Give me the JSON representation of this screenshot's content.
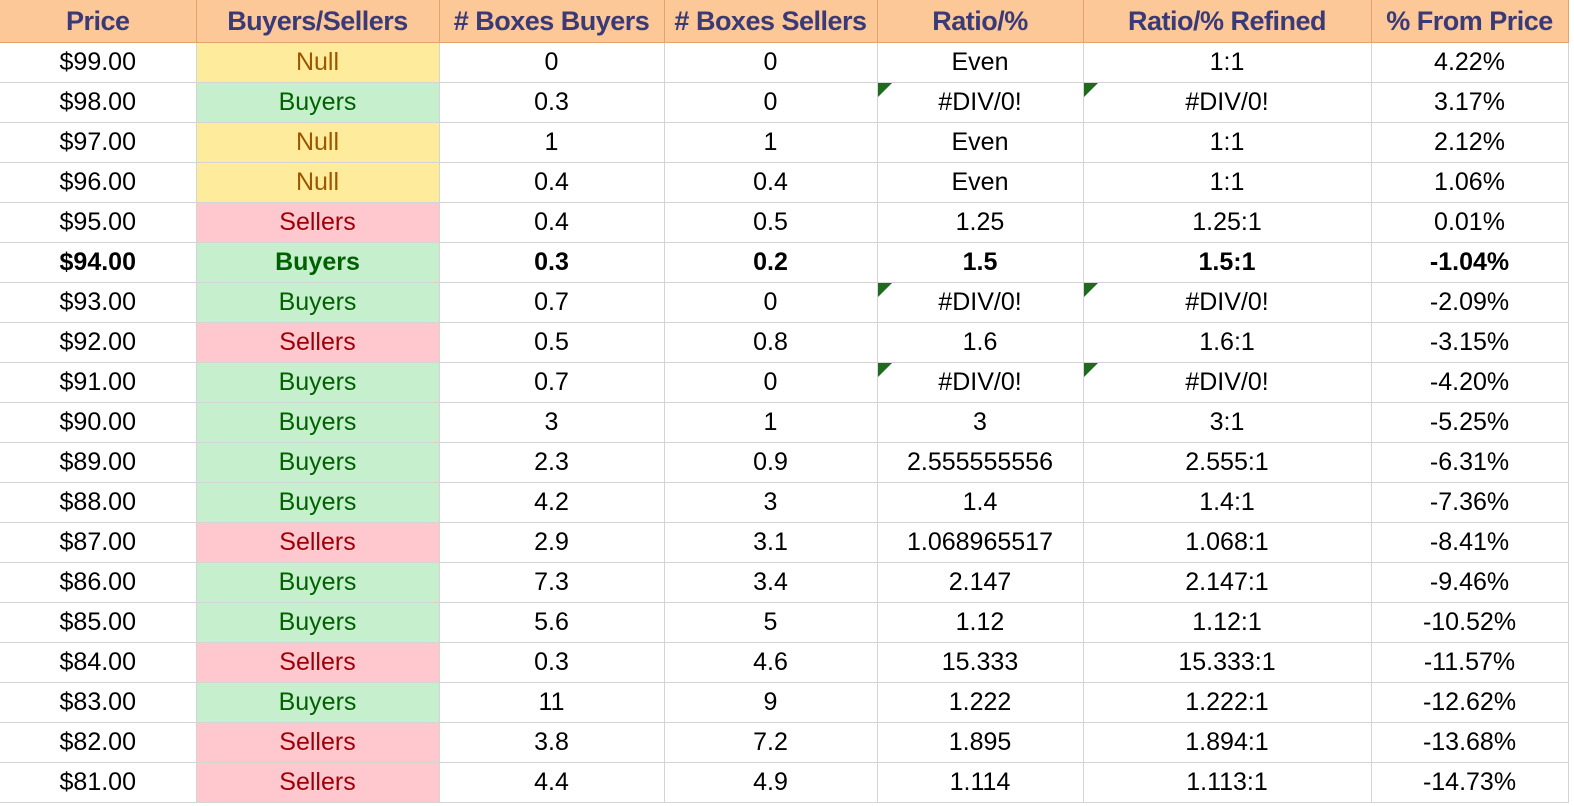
{
  "columns": [
    "Price",
    "Buyers/Sellers",
    "# Boxes Buyers",
    "# Boxes Sellers",
    "Ratio/%",
    "Ratio/% Refined",
    "% From Price"
  ],
  "rows": [
    {
      "price": "$99.00",
      "side": "Null",
      "side_type": "null",
      "buyers": "0",
      "sellers": "0",
      "ratio": "Even",
      "refined": "1:1",
      "from_price": "4.22%",
      "error_flag": false,
      "bold": false
    },
    {
      "price": "$98.00",
      "side": "Buyers",
      "side_type": "buyers",
      "buyers": "0.3",
      "sellers": "0",
      "ratio": "#DIV/0!",
      "refined": "#DIV/0!",
      "from_price": "3.17%",
      "error_flag": true,
      "bold": false
    },
    {
      "price": "$97.00",
      "side": "Null",
      "side_type": "null",
      "buyers": "1",
      "sellers": "1",
      "ratio": "Even",
      "refined": "1:1",
      "from_price": "2.12%",
      "error_flag": false,
      "bold": false
    },
    {
      "price": "$96.00",
      "side": "Null",
      "side_type": "null",
      "buyers": "0.4",
      "sellers": "0.4",
      "ratio": "Even",
      "refined": "1:1",
      "from_price": "1.06%",
      "error_flag": false,
      "bold": false
    },
    {
      "price": "$95.00",
      "side": "Sellers",
      "side_type": "sellers",
      "buyers": "0.4",
      "sellers": "0.5",
      "ratio": "1.25",
      "refined": "1.25:1",
      "from_price": "0.01%",
      "error_flag": false,
      "bold": false
    },
    {
      "price": "$94.00",
      "side": "Buyers",
      "side_type": "buyers",
      "buyers": "0.3",
      "sellers": "0.2",
      "ratio": "1.5",
      "refined": "1.5:1",
      "from_price": "-1.04%",
      "error_flag": false,
      "bold": true
    },
    {
      "price": "$93.00",
      "side": "Buyers",
      "side_type": "buyers",
      "buyers": "0.7",
      "sellers": "0",
      "ratio": "#DIV/0!",
      "refined": "#DIV/0!",
      "from_price": "-2.09%",
      "error_flag": true,
      "bold": false
    },
    {
      "price": "$92.00",
      "side": "Sellers",
      "side_type": "sellers",
      "buyers": "0.5",
      "sellers": "0.8",
      "ratio": "1.6",
      "refined": "1.6:1",
      "from_price": "-3.15%",
      "error_flag": false,
      "bold": false
    },
    {
      "price": "$91.00",
      "side": "Buyers",
      "side_type": "buyers",
      "buyers": "0.7",
      "sellers": "0",
      "ratio": "#DIV/0!",
      "refined": "#DIV/0!",
      "from_price": "-4.20%",
      "error_flag": true,
      "bold": false
    },
    {
      "price": "$90.00",
      "side": "Buyers",
      "side_type": "buyers",
      "buyers": "3",
      "sellers": "1",
      "ratio": "3",
      "refined": "3:1",
      "from_price": "-5.25%",
      "error_flag": false,
      "bold": false
    },
    {
      "price": "$89.00",
      "side": "Buyers",
      "side_type": "buyers",
      "buyers": "2.3",
      "sellers": "0.9",
      "ratio": "2.555555556",
      "refined": "2.555:1",
      "from_price": "-6.31%",
      "error_flag": false,
      "bold": false
    },
    {
      "price": "$88.00",
      "side": "Buyers",
      "side_type": "buyers",
      "buyers": "4.2",
      "sellers": "3",
      "ratio": "1.4",
      "refined": "1.4:1",
      "from_price": "-7.36%",
      "error_flag": false,
      "bold": false
    },
    {
      "price": "$87.00",
      "side": "Sellers",
      "side_type": "sellers",
      "buyers": "2.9",
      "sellers": "3.1",
      "ratio": "1.068965517",
      "refined": "1.068:1",
      "from_price": "-8.41%",
      "error_flag": false,
      "bold": false
    },
    {
      "price": "$86.00",
      "side": "Buyers",
      "side_type": "buyers",
      "buyers": "7.3",
      "sellers": "3.4",
      "ratio": "2.147",
      "refined": "2.147:1",
      "from_price": "-9.46%",
      "error_flag": false,
      "bold": false
    },
    {
      "price": "$85.00",
      "side": "Buyers",
      "side_type": "buyers",
      "buyers": "5.6",
      "sellers": "5",
      "ratio": "1.12",
      "refined": "1.12:1",
      "from_price": "-10.52%",
      "error_flag": false,
      "bold": false
    },
    {
      "price": "$84.00",
      "side": "Sellers",
      "side_type": "sellers",
      "buyers": "0.3",
      "sellers": "4.6",
      "ratio": "15.333",
      "refined": "15.333:1",
      "from_price": "-11.57%",
      "error_flag": false,
      "bold": false
    },
    {
      "price": "$83.00",
      "side": "Buyers",
      "side_type": "buyers",
      "buyers": "11",
      "sellers": "9",
      "ratio": "1.222",
      "refined": "1.222:1",
      "from_price": "-12.62%",
      "error_flag": false,
      "bold": false
    },
    {
      "price": "$82.00",
      "side": "Sellers",
      "side_type": "sellers",
      "buyers": "3.8",
      "sellers": "7.2",
      "ratio": "1.895",
      "refined": "1.894:1",
      "from_price": "-13.68%",
      "error_flag": false,
      "bold": false
    },
    {
      "price": "$81.00",
      "side": "Sellers",
      "side_type": "sellers",
      "buyers": "4.4",
      "sellers": "4.9",
      "ratio": "1.114",
      "refined": "1.113:1",
      "from_price": "-14.73%",
      "error_flag": false,
      "bold": false
    }
  ],
  "colors": {
    "header_bg": "#fdc897",
    "header_text": "#3a3a78",
    "buyers_bg": "#c6efce",
    "buyers_text": "#006100",
    "sellers_bg": "#ffc7ce",
    "sellers_text": "#9c0006",
    "null_bg": "#ffeb9c",
    "null_text": "#9c5700",
    "error_flag": "#1e6b1e"
  }
}
